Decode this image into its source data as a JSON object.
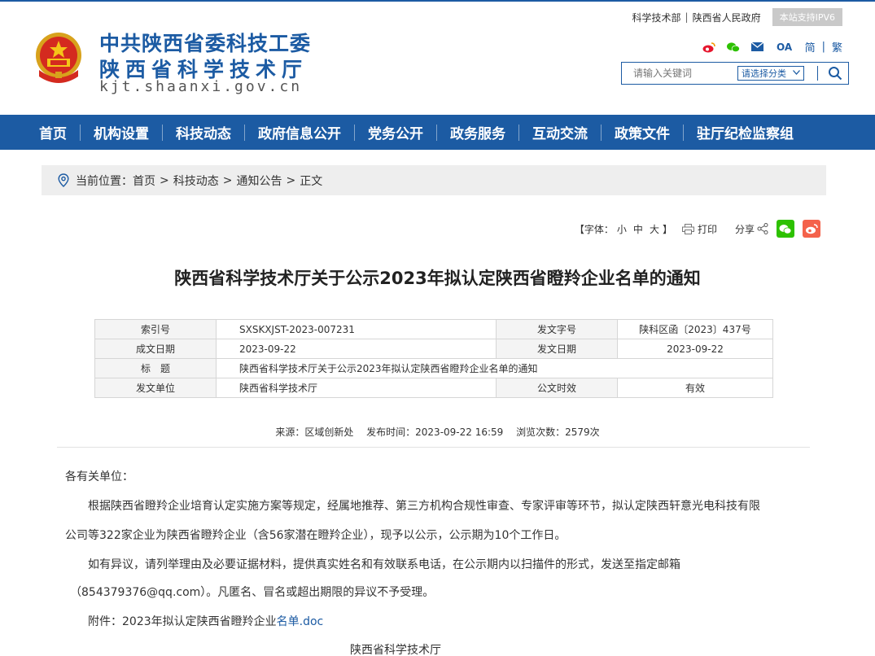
{
  "header": {
    "org_line1": "中共陕西省委科技工委",
    "org_line2": "陕西省科学技术厅",
    "domain": "kjt.shaanxi.gov.cn",
    "top_links": [
      "科学技术部",
      "陕西省人民政府"
    ],
    "top_sep": "|",
    "ipv6_badge": "本站支持IPV6",
    "socials": {
      "weibo": "weibo-icon",
      "wechat": "wechat-icon",
      "mail": "mail-icon",
      "oa": "OA"
    },
    "lang_simplified": "简",
    "lang_traditional": "繁",
    "lang_sep": "|",
    "search": {
      "placeholder": "请输入关键词",
      "category": "请选择分类"
    }
  },
  "nav": {
    "items": [
      "首页",
      "机构设置",
      "科技动态",
      "政府信息公开",
      "党务公开",
      "政务服务",
      "互动交流",
      "政策文件",
      "驻厅纪检监察组"
    ]
  },
  "breadcrumb": {
    "prefix": "当前位置：",
    "items": [
      "首页",
      "科技动态",
      "通知公告",
      "正文"
    ],
    "sep": ">"
  },
  "tools": {
    "font_label": "【字体：",
    "font_small": "小",
    "font_medium": "中",
    "font_large": "大",
    "font_close": "】",
    "print_label": "打印",
    "share_label": "分享"
  },
  "article": {
    "title": "陕西省科学技术厅关于公示2023年拟认定陕西省瞪羚企业名单的通知",
    "meta": {
      "index_label": "索引号",
      "index_value": "SXSKXJST-2023-007231",
      "docno_label": "发文字号",
      "docno_value": "陕科区函〔2023〕437号",
      "created_label": "成文日期",
      "created_value": "2023-09-22",
      "issued_label": "发文日期",
      "issued_value": "2023-09-22",
      "subject_label": "标　题",
      "subject_value": "陕西省科学技术厅关于公示2023年拟认定陕西省瞪羚企业名单的通知",
      "issuer_label": "发文单位",
      "issuer_value": "陕西省科学技术厅",
      "validity_label": "公文时效",
      "validity_value": "有效"
    },
    "source": "来源：区域创新处",
    "published": "发布时间：2023-09-22 16:59",
    "views": "浏览次数：2579次",
    "salutation": "各有关单位：",
    "para1_line1": "根据陕西省瞪羚企业培育认定实施方案等规定，经属地推荐、第三方机构合规性审查、专家评审等环节，拟认定陕西轩意光电科技有限",
    "para1_line2": "公司等322家企业为陕西省瞪羚企业（含56家潜在瞪羚企业），现予以公示，公示期为10个工作日。",
    "para2_line1": "如有异议，请列举理由及必要证据材料，提供真实姓名和有效联系电话，在公示期内以扫描件的形式，发送至指定邮箱",
    "para2_line2": "（854379376@qq.com）。凡匿名、冒名或超出期限的异议不予受理。",
    "attachment_prefix": "附件：2023年拟认定陕西省瞪羚企业",
    "attachment_link": "名单.doc",
    "signature": "陕西省科学技术厅"
  },
  "colors": {
    "brand_blue": "#1c5ba3",
    "wechat_green": "#2dc100",
    "weibo_red": "#f4624b"
  }
}
